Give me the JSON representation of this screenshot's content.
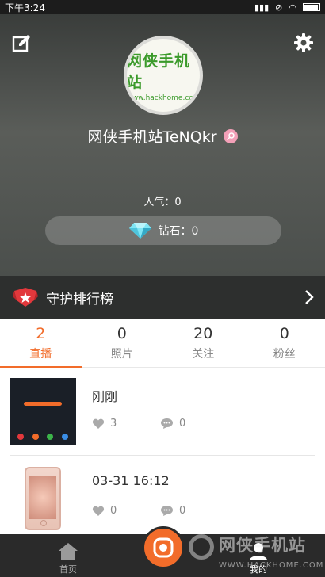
{
  "status_bar": {
    "time": "下午3:24"
  },
  "profile": {
    "nickname": "网侠手机站TeNQkr",
    "avatar_logo_text": "网侠手机站",
    "avatar_logo_url": "www.hackhome.com",
    "popularity": "人气：0",
    "diamonds": "钻石：0"
  },
  "rank": {
    "label": "守护排行榜"
  },
  "tabs": [
    {
      "count": "2",
      "label": "直播",
      "active": true
    },
    {
      "count": "0",
      "label": "照片"
    },
    {
      "count": "20",
      "label": "关注"
    },
    {
      "count": "0",
      "label": "粉丝"
    }
  ],
  "feed": [
    {
      "title": "刚刚",
      "likes": "3",
      "comments": "0"
    },
    {
      "title": "03-31 16:12",
      "likes": "0",
      "comments": "0"
    }
  ],
  "bottom_nav": {
    "home_label": "首页",
    "mine_label": "我的"
  },
  "watermark": {
    "text": "网侠手机站",
    "url": "WWW.HACKHOME.COM"
  },
  "colors": {
    "accent": "#f26c2a",
    "header_dark": "#3a3d3b",
    "nav_bg": "#2a2a2a"
  }
}
